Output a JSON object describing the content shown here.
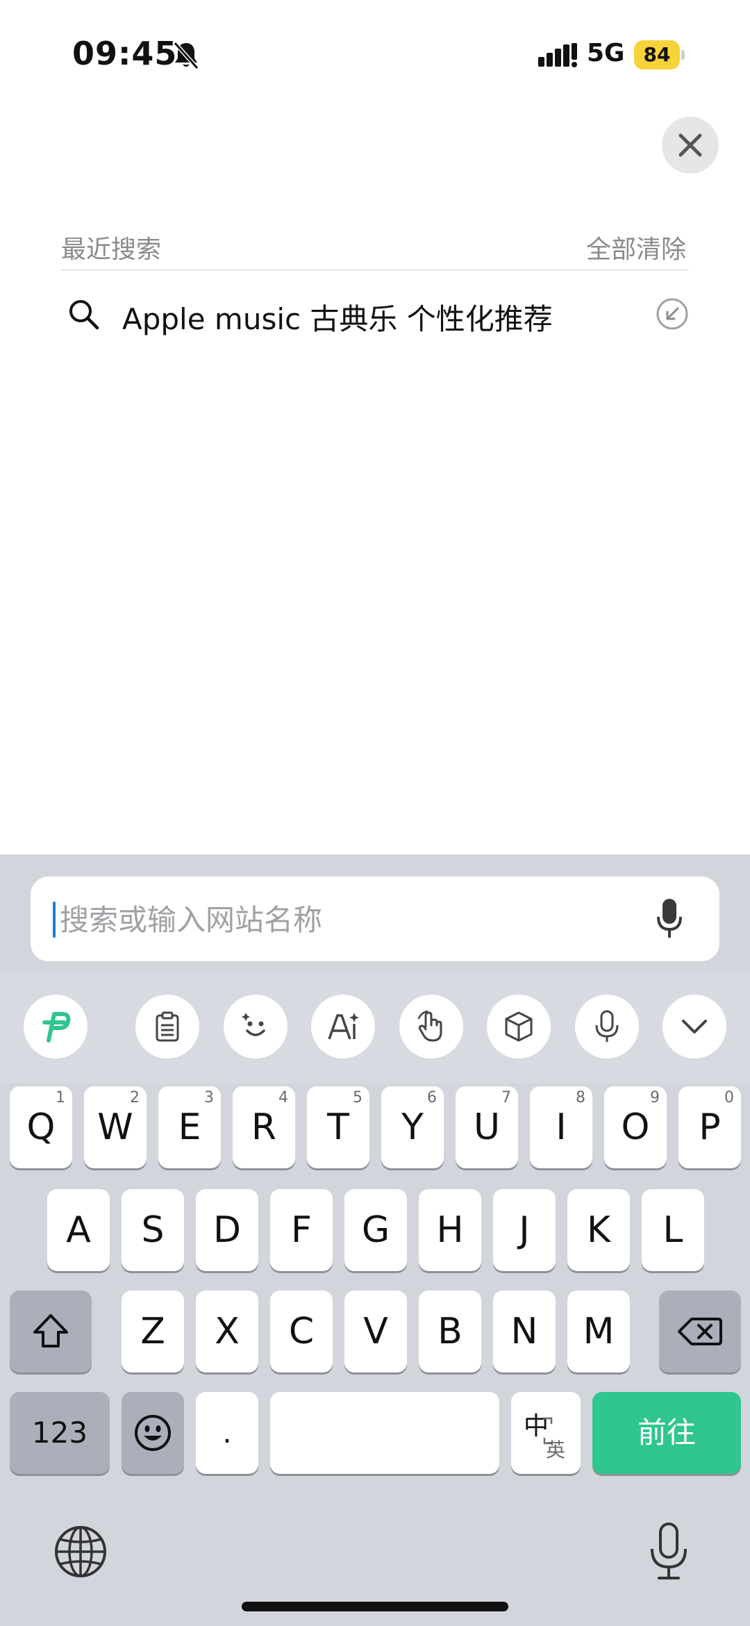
{
  "status_bar": {
    "time": "09:45",
    "network": "5G",
    "battery_level": "84",
    "battery_color": "#f7d33a",
    "icons": [
      "bell-slash-icon",
      "signal-icon"
    ]
  },
  "close_button": {
    "icon": "close-icon"
  },
  "recent": {
    "title": "最近搜索",
    "clear_all": "全部清除",
    "items": [
      {
        "text": "Apple music 古典乐 个性化推荐",
        "icon": "search-icon",
        "action_icon": "fill-arrow-icon"
      }
    ]
  },
  "search": {
    "placeholder": "搜索或输入网站名称",
    "value": "",
    "mic_icon": "microphone-icon"
  },
  "toolbar": {
    "items": [
      "ime-logo-icon",
      "clipboard-icon",
      "emoji-face-icon",
      "ai-writing-icon",
      "gesture-hand-icon",
      "cube-icon",
      "microphone-icon",
      "chevron-down-icon"
    ],
    "accent": "#2fc68f"
  },
  "keyboard": {
    "row1": [
      {
        "key": "Q",
        "num": "1"
      },
      {
        "key": "W",
        "num": "2"
      },
      {
        "key": "E",
        "num": "3"
      },
      {
        "key": "R",
        "num": "4"
      },
      {
        "key": "T",
        "num": "5"
      },
      {
        "key": "Y",
        "num": "6"
      },
      {
        "key": "U",
        "num": "7"
      },
      {
        "key": "I",
        "num": "8"
      },
      {
        "key": "O",
        "num": "9"
      },
      {
        "key": "P",
        "num": "0"
      }
    ],
    "row2": [
      "A",
      "S",
      "D",
      "F",
      "G",
      "H",
      "J",
      "K",
      "L"
    ],
    "row3": [
      "Z",
      "X",
      "C",
      "V",
      "B",
      "N",
      "M"
    ],
    "numbers_key": "123",
    "period_key": ".",
    "lang_key_zh": "中",
    "lang_key_en": "英",
    "go_key": "前往",
    "go_color": "#2fc68f"
  }
}
